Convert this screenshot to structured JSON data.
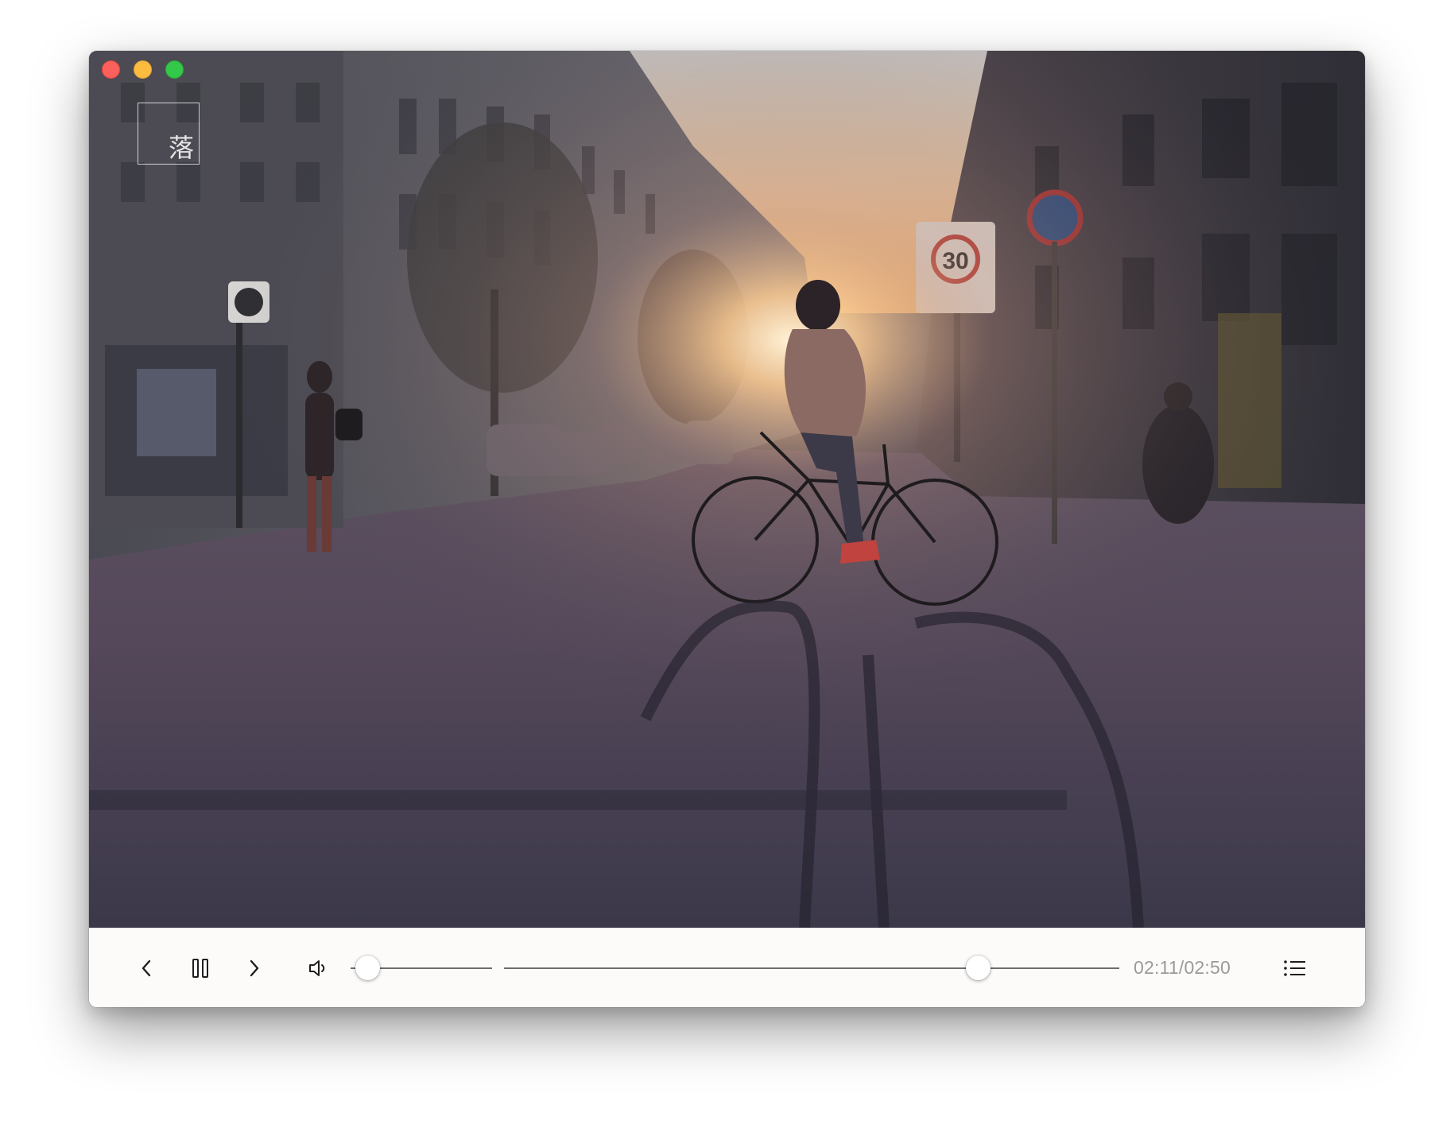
{
  "window": {
    "traffic_lights": [
      "close",
      "minimize",
      "zoom"
    ],
    "colors": {
      "close": "#fc605c",
      "minimize": "#fdbc40",
      "zoom": "#34c84a"
    }
  },
  "logo": {
    "text": "落"
  },
  "video": {
    "description_icon": "street-cyclist-sunset-frame"
  },
  "controls": {
    "prev_icon": "chevron-left-icon",
    "pause_icon": "pause-icon",
    "next_icon": "chevron-right-icon",
    "volume_icon": "speaker-icon",
    "volume_level": 0.0,
    "progress_fraction": 0.77,
    "time_text": "02:11/02:50",
    "playlist_icon": "playlist-icon"
  },
  "accent_colors": {
    "track": "#6d6d6d",
    "time_text": "#9a9a9a",
    "bar_bg": "#fdfbfa"
  }
}
